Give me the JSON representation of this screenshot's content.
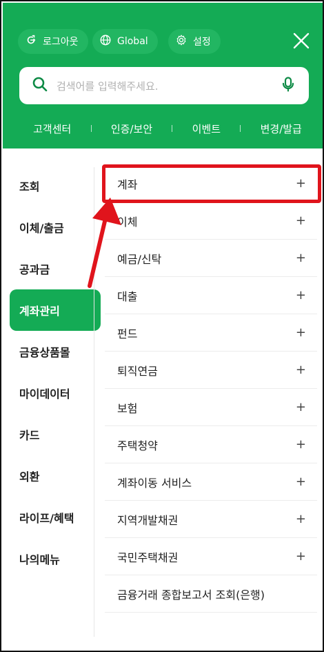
{
  "header": {
    "logout_label": "로그아웃",
    "global_label": "Global",
    "settings_label": "설정",
    "close_icon": "close-icon"
  },
  "search": {
    "placeholder": "검색어를 입력해주세요."
  },
  "quick_links": [
    "고객센터",
    "인증/보안",
    "이벤트",
    "변경/발급"
  ],
  "sidebar": {
    "items": [
      {
        "label": "조회"
      },
      {
        "label": "이체/출금"
      },
      {
        "label": "공과금"
      },
      {
        "label": "계좌관리",
        "active": true
      },
      {
        "label": "금융상품몰"
      },
      {
        "label": "마이데이터"
      },
      {
        "label": "카드"
      },
      {
        "label": "외환"
      },
      {
        "label": "라이프/혜택"
      },
      {
        "label": "나의메뉴"
      }
    ]
  },
  "submenu": {
    "items": [
      {
        "label": "계좌",
        "expandable": true
      },
      {
        "label": "이체",
        "expandable": true
      },
      {
        "label": "예금/신탁",
        "expandable": true
      },
      {
        "label": "대출",
        "expandable": true
      },
      {
        "label": "펀드",
        "expandable": true
      },
      {
        "label": "퇴직연금",
        "expandable": true
      },
      {
        "label": "보험",
        "expandable": true
      },
      {
        "label": "주택청약",
        "expandable": true
      },
      {
        "label": "계좌이동 서비스",
        "expandable": true
      },
      {
        "label": "지역개발채권",
        "expandable": true
      },
      {
        "label": "국민주택채권",
        "expandable": true
      },
      {
        "label": "금융거래 종합보고서 조회(은행)",
        "expandable": false
      }
    ],
    "plus_symbol": "+"
  },
  "colors": {
    "brand_green": "#14ab55",
    "annotation_red": "#e0141c"
  }
}
